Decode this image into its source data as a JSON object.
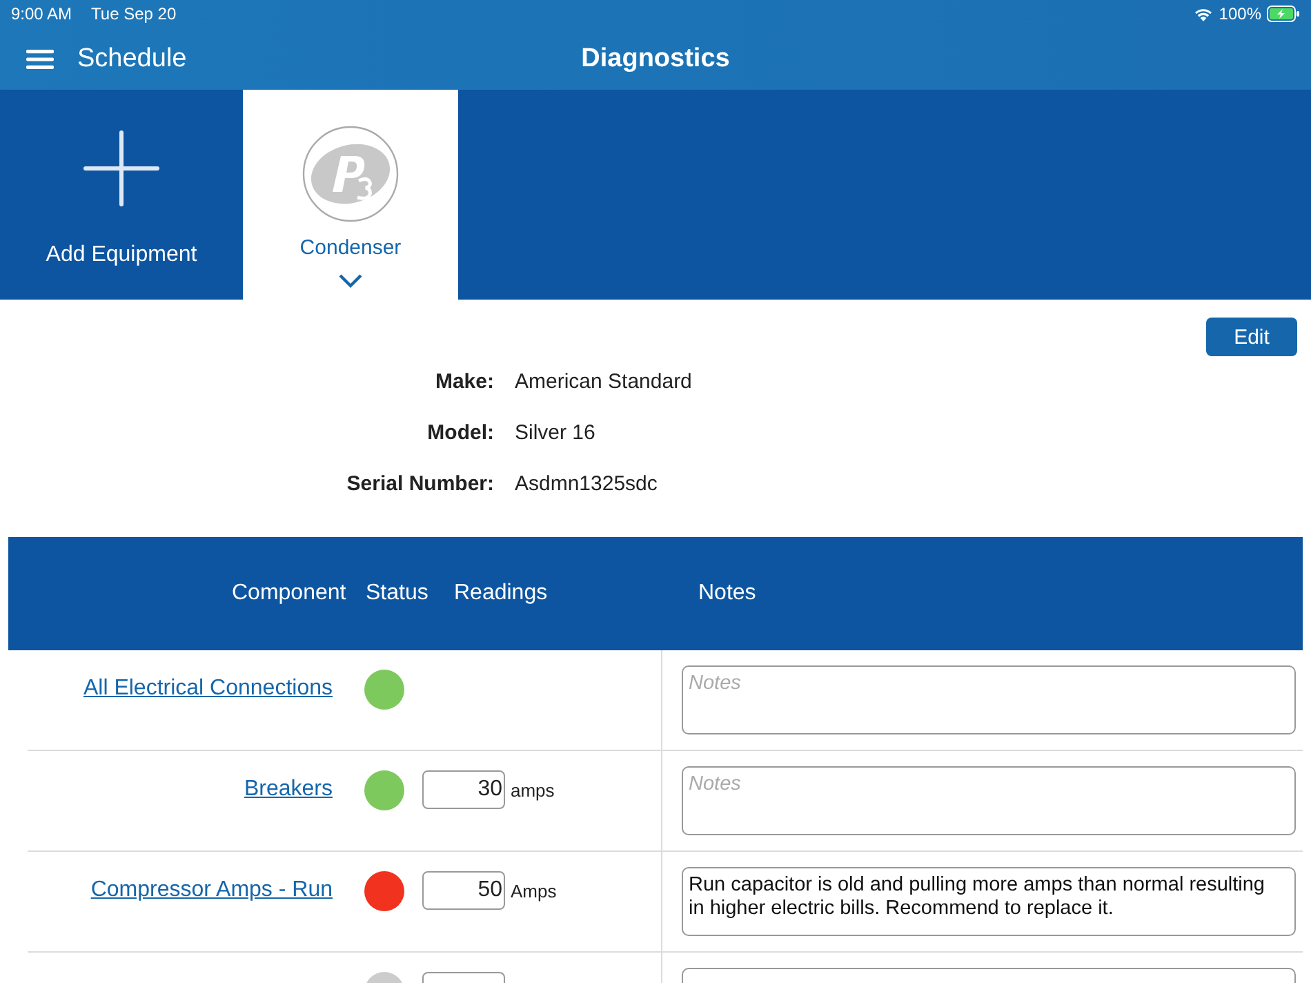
{
  "status_bar": {
    "time": "9:00 AM",
    "date": "Tue Sep 20",
    "battery": "100%"
  },
  "nav": {
    "back_label": "Schedule",
    "title": "Diagnostics"
  },
  "equipment_tabs": [
    {
      "kind": "add",
      "label": "Add Equipment",
      "selected": false
    },
    {
      "kind": "equipment",
      "label": "Condenser",
      "selected": true
    }
  ],
  "edit_button": "Edit",
  "details": [
    {
      "label": "Make:",
      "value": "American Standard"
    },
    {
      "label": "Model:",
      "value": "Silver 16"
    },
    {
      "label": "Serial Number:",
      "value": "Asdmn1325sdc"
    }
  ],
  "table": {
    "columns": [
      "Component",
      "Status",
      "Readings",
      "Notes"
    ],
    "rows": [
      {
        "component": "All Electrical Connections",
        "color": "#7dc95e",
        "reading": null,
        "unit": null,
        "notes": "",
        "placeholder": "Notes"
      },
      {
        "component": "Breakers",
        "color": "#7dc95e",
        "reading": "30",
        "unit": "amps",
        "notes": "",
        "placeholder": "Notes"
      },
      {
        "component": "Compressor Amps - Run",
        "color": "#f0321e",
        "reading": "50",
        "unit": "Amps",
        "notes": "Run capacitor is old and pulling more amps than normal resulting in higher electric bills.  Recommend to replace it."
      },
      {
        "color": "#cccccc",
        "reading": "",
        "unit": null,
        "notes": ""
      }
    ]
  }
}
